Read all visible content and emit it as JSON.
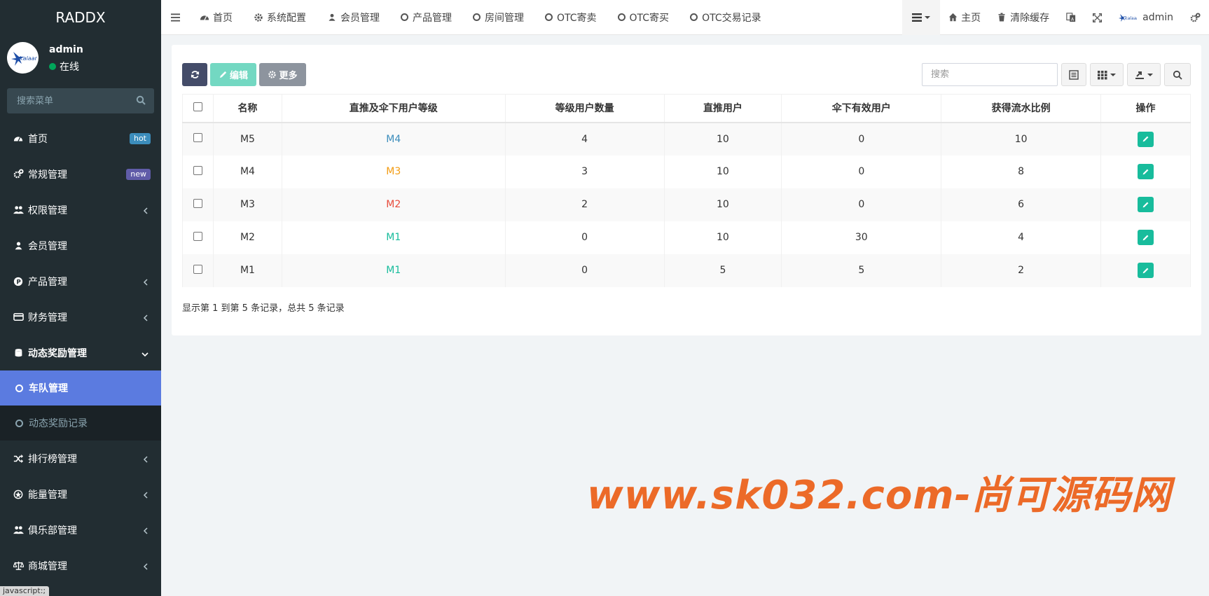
{
  "app": {
    "logo": "RADDX",
    "user": {
      "name": "admin",
      "status": "在线"
    }
  },
  "sidebar": {
    "search_placeholder": "搜索菜单",
    "items": [
      {
        "label": "首页",
        "icon": "dashboard-icon",
        "badge": "hot"
      },
      {
        "label": "常规管理",
        "icon": "cogs-icon",
        "badge": "new"
      },
      {
        "label": "权限管理",
        "icon": "group-icon"
      },
      {
        "label": "会员管理",
        "icon": "user-icon"
      },
      {
        "label": "产品管理",
        "icon": "product-icon"
      },
      {
        "label": "财务管理",
        "icon": "credit-card-icon"
      },
      {
        "label": "动态奖励管理",
        "icon": "database-icon"
      },
      {
        "label": "排行榜管理",
        "icon": "random-icon"
      },
      {
        "label": "能量管理",
        "icon": "energy-icon"
      },
      {
        "label": "俱乐部管理",
        "icon": "group-icon"
      },
      {
        "label": "商城管理",
        "icon": "balance-scale-icon"
      }
    ],
    "submenu": [
      {
        "label": "车队管理"
      },
      {
        "label": "动态奖励记录"
      }
    ],
    "status_tooltip": "javascript:;"
  },
  "topnav": {
    "items": [
      {
        "label": "首页",
        "icon": "dashboard-icon"
      },
      {
        "label": "系统配置",
        "icon": "gear-icon"
      },
      {
        "label": "会员管理",
        "icon": "user-icon"
      },
      {
        "label": "产品管理",
        "icon": "circle-icon"
      },
      {
        "label": "房间管理",
        "icon": "circle-icon"
      },
      {
        "label": "OTC寄卖",
        "icon": "circle-icon"
      },
      {
        "label": "OTC寄买",
        "icon": "circle-icon"
      },
      {
        "label": "OTC交易记录",
        "icon": "circle-icon"
      }
    ],
    "right": {
      "home": "主页",
      "clear_cache": "清除缓存",
      "admin": "admin"
    }
  },
  "toolbar": {
    "edit": "编辑",
    "more": "更多",
    "search_placeholder": "搜索"
  },
  "table": {
    "columns": [
      "名称",
      "直推及伞下用户等级",
      "等级用户数量",
      "直推用户",
      "伞下有效用户",
      "获得流水比例",
      "操作"
    ],
    "rows": [
      {
        "name": "M5",
        "level": "M4",
        "level_color": "#3c8dbc",
        "count": "4",
        "direct": "10",
        "effective": "0",
        "ratio": "10"
      },
      {
        "name": "M4",
        "level": "M3",
        "level_color": "#f39c12",
        "count": "3",
        "direct": "10",
        "effective": "0",
        "ratio": "8"
      },
      {
        "name": "M3",
        "level": "M2",
        "level_color": "#e74c3c",
        "count": "2",
        "direct": "10",
        "effective": "0",
        "ratio": "6"
      },
      {
        "name": "M2",
        "level": "M1",
        "level_color": "#18bc9c",
        "count": "0",
        "direct": "10",
        "effective": "30",
        "ratio": "4"
      },
      {
        "name": "M1",
        "level": "M1",
        "level_color": "#18bc9c",
        "count": "0",
        "direct": "5",
        "effective": "5",
        "ratio": "2"
      }
    ]
  },
  "pagination": {
    "summary": "显示第 1 到第 5 条记录，总共 5 条记录"
  },
  "watermark": "www.sk032.com-尚可源码网",
  "colors": {
    "sidebar_bg": "#222d32",
    "active_menu": "#5b7be0",
    "primary_dark": "#444c69",
    "success": "#18bc9c",
    "watermark": "#ec6a28"
  }
}
